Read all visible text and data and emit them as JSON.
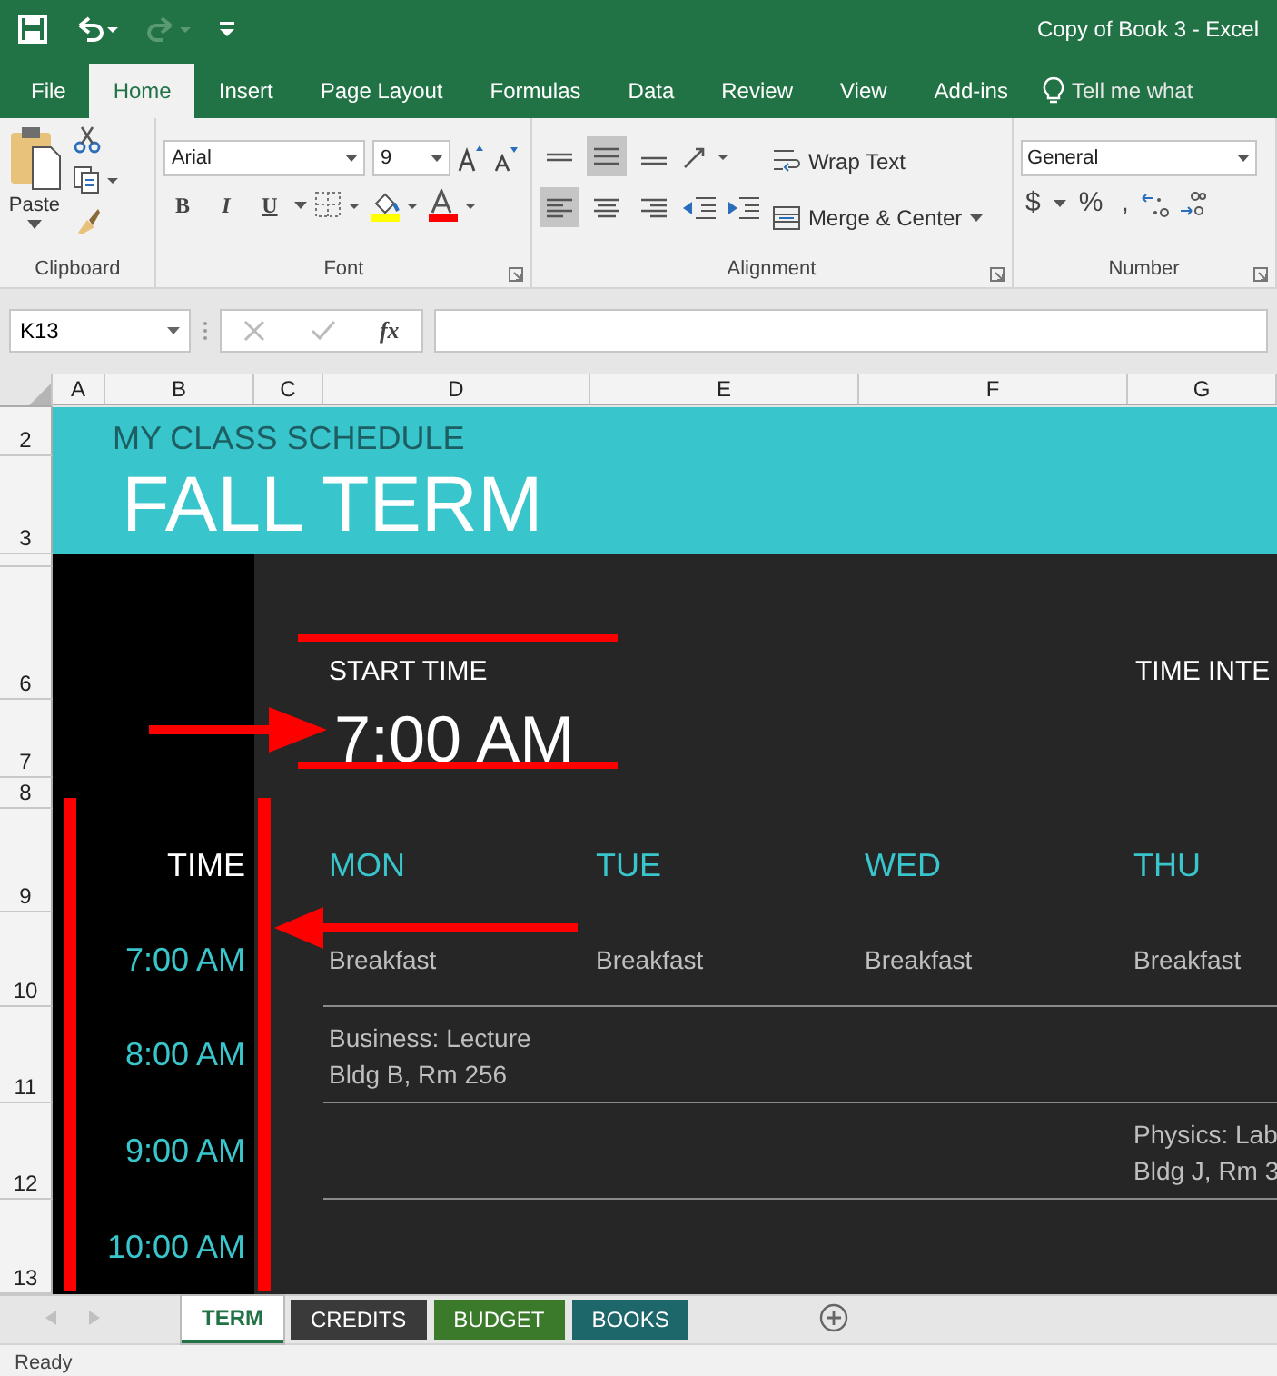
{
  "title_bar": {
    "document_title": "Copy of Book 3  -  Excel"
  },
  "ribbon_tabs": [
    {
      "label": "File",
      "selected": false
    },
    {
      "label": "Home",
      "selected": true
    },
    {
      "label": "Insert",
      "selected": false
    },
    {
      "label": "Page Layout",
      "selected": false
    },
    {
      "label": "Formulas",
      "selected": false
    },
    {
      "label": "Data",
      "selected": false
    },
    {
      "label": "Review",
      "selected": false
    },
    {
      "label": "View",
      "selected": false
    },
    {
      "label": "Add-ins",
      "selected": false
    }
  ],
  "tell_me": "Tell me what",
  "ribbon": {
    "clipboard": {
      "paste_label": "Paste",
      "group_label": "Clipboard"
    },
    "font": {
      "font_name": "Arial",
      "font_size": "9",
      "bold": "B",
      "italic": "I",
      "underline": "U",
      "group_label": "Font"
    },
    "alignment": {
      "vertical": [
        {
          "kind": "top",
          "selected": false
        },
        {
          "kind": "middle",
          "selected": true
        },
        {
          "kind": "bottom",
          "selected": false
        }
      ],
      "horizontal": [
        {
          "kind": "left",
          "selected": true
        },
        {
          "kind": "center",
          "selected": false
        },
        {
          "kind": "right",
          "selected": false
        }
      ],
      "wrap_text": "Wrap Text",
      "merge_center": "Merge & Center",
      "group_label": "Alignment"
    },
    "number": {
      "format": "General",
      "currency": "$",
      "percent": "%",
      "comma": ",",
      "group_label": "Number"
    }
  },
  "formula_bar": {
    "name_box": "K13",
    "fx": "fx"
  },
  "columns": [
    "A",
    "B",
    "C",
    "D",
    "E",
    "F",
    "G"
  ],
  "row_numbers": [
    "2",
    "3",
    "6",
    "7",
    "8",
    "9",
    "10",
    "11",
    "12",
    "13"
  ],
  "schedule": {
    "subtitle": "MY CLASS SCHEDULE",
    "title": "FALL TERM",
    "start_time_label": "START TIME",
    "start_time": "7:00 AM",
    "time_interval_label": "TIME INTE",
    "time_header": "TIME",
    "days": [
      "MON",
      "TUE",
      "WED",
      "THU"
    ],
    "slots": [
      {
        "time": "7:00 AM",
        "cells": [
          [
            "Breakfast"
          ],
          [
            "Breakfast"
          ],
          [
            "Breakfast"
          ],
          [
            "Breakfast"
          ]
        ]
      },
      {
        "time": "8:00 AM",
        "cells": [
          [
            "Business: Lecture",
            "Bldg B, Rm 256"
          ],
          null,
          null,
          null
        ]
      },
      {
        "time": "9:00 AM",
        "cells": [
          null,
          null,
          null,
          [
            "Physics: Lab",
            "Bldg J, Rm 3"
          ]
        ]
      },
      {
        "time": "10:00 AM",
        "cells": [
          null,
          null,
          null,
          null
        ]
      }
    ]
  },
  "sheet_tabs": [
    {
      "label": "TERM",
      "selected": true,
      "color": "#217346"
    },
    {
      "label": "CREDITS",
      "selected": false,
      "color": "#3a3a3a"
    },
    {
      "label": "BUDGET",
      "selected": false,
      "color": "#3b7a2b"
    },
    {
      "label": "BOOKS",
      "selected": false,
      "color": "#1d6669"
    }
  ],
  "status_bar": {
    "text": "Ready"
  }
}
